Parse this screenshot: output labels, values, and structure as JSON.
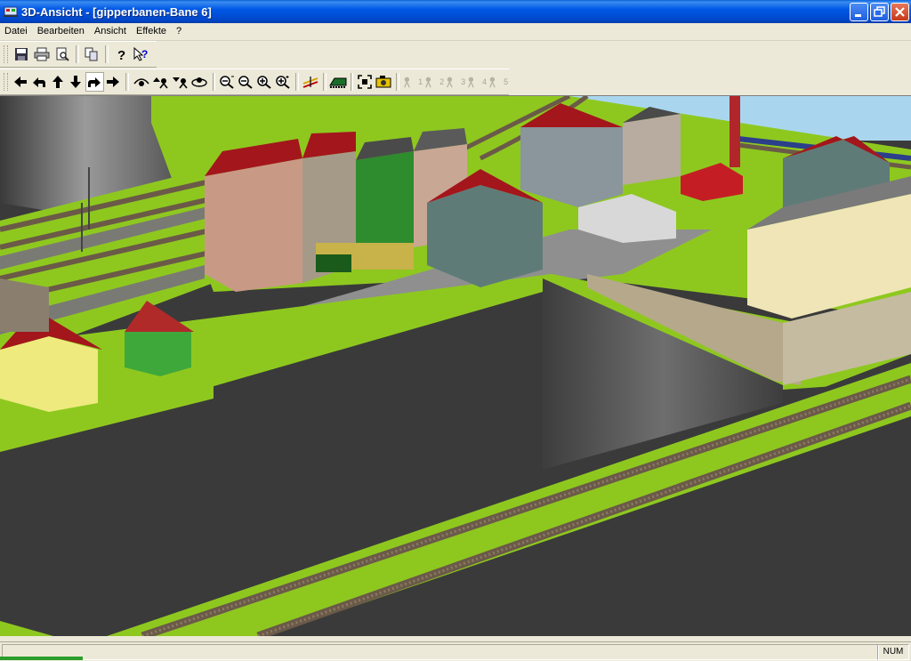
{
  "window": {
    "title": "3D-Ansicht - [gipperbanen-Bane 6]",
    "controls": [
      "minimize",
      "maximize",
      "close"
    ]
  },
  "menu": {
    "items": [
      {
        "label": "Datei"
      },
      {
        "label": "Bearbeiten"
      },
      {
        "label": "Ansicht"
      },
      {
        "label": "Effekte"
      },
      {
        "label": "?"
      }
    ]
  },
  "toolbar_file": {
    "buttons": [
      {
        "name": "save-icon"
      },
      {
        "name": "print-icon"
      },
      {
        "name": "print-preview-icon"
      },
      {
        "name": "copy-icon"
      },
      {
        "name": "help-icon"
      },
      {
        "name": "context-help-icon"
      }
    ]
  },
  "toolbar_view": {
    "buttons": [
      {
        "name": "move-left-icon"
      },
      {
        "name": "turn-left-icon"
      },
      {
        "name": "move-up-icon"
      },
      {
        "name": "move-down-icon"
      },
      {
        "name": "turn-right-icon"
      },
      {
        "name": "move-right-icon"
      },
      {
        "name": "tilt-icon"
      },
      {
        "name": "raise-view-icon"
      },
      {
        "name": "lower-view-icon"
      },
      {
        "name": "orbit-icon"
      },
      {
        "name": "zoom-out-fast-icon"
      },
      {
        "name": "zoom-out-icon"
      },
      {
        "name": "zoom-in-icon"
      },
      {
        "name": "zoom-in-fast-icon"
      },
      {
        "name": "signal-icon"
      },
      {
        "name": "train-view-icon"
      },
      {
        "name": "fit-view-icon"
      },
      {
        "name": "camera-icon"
      }
    ],
    "camera_positions": [
      "1",
      "2",
      "3",
      "4",
      "5"
    ]
  },
  "status": {
    "indicator": "NUM"
  },
  "colors": {
    "grass": "#8ec81f",
    "ground": "#3a3a3a",
    "sky": "#a9d6ee",
    "track": "#6b5a48",
    "road": "#8f8f8f",
    "roof_red": "#a3161c"
  }
}
